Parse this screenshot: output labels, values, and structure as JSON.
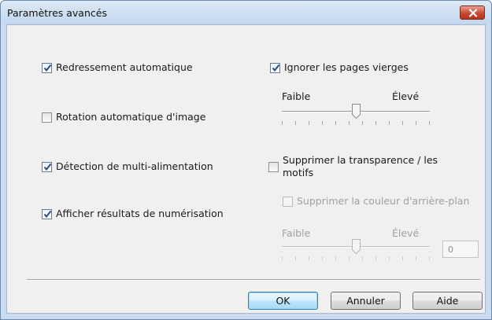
{
  "window": {
    "title": "Paramètres avancés"
  },
  "options": {
    "auto_deskew": {
      "label": "Redressement automatique",
      "checked": true
    },
    "auto_rotate": {
      "label": "Rotation automatique d'image",
      "checked": false
    },
    "multifeed_detection": {
      "label": "Détection de multi-alimentation",
      "checked": true
    },
    "show_results": {
      "label": "Afficher résultats de numérisation",
      "checked": true
    },
    "skip_blank": {
      "label": "Ignorer les pages vierges",
      "checked": true
    },
    "remove_bleed": {
      "label_line1": "Supprimer la transparence / les",
      "label_line2": "motifs",
      "checked": false
    },
    "remove_background": {
      "label": "Supprimer la couleur d'arrière-plan",
      "checked": false,
      "enabled": false
    }
  },
  "blank_sensitivity": {
    "min_label": "Faible",
    "max_label": "Élevé",
    "level_fraction": 0.5
  },
  "background_sensitivity": {
    "min_label": "Faible",
    "max_label": "Élevé",
    "level_fraction": 0.5,
    "value": "0",
    "enabled": false
  },
  "buttons": {
    "ok": "OK",
    "cancel": "Annuler",
    "help": "Aide"
  }
}
